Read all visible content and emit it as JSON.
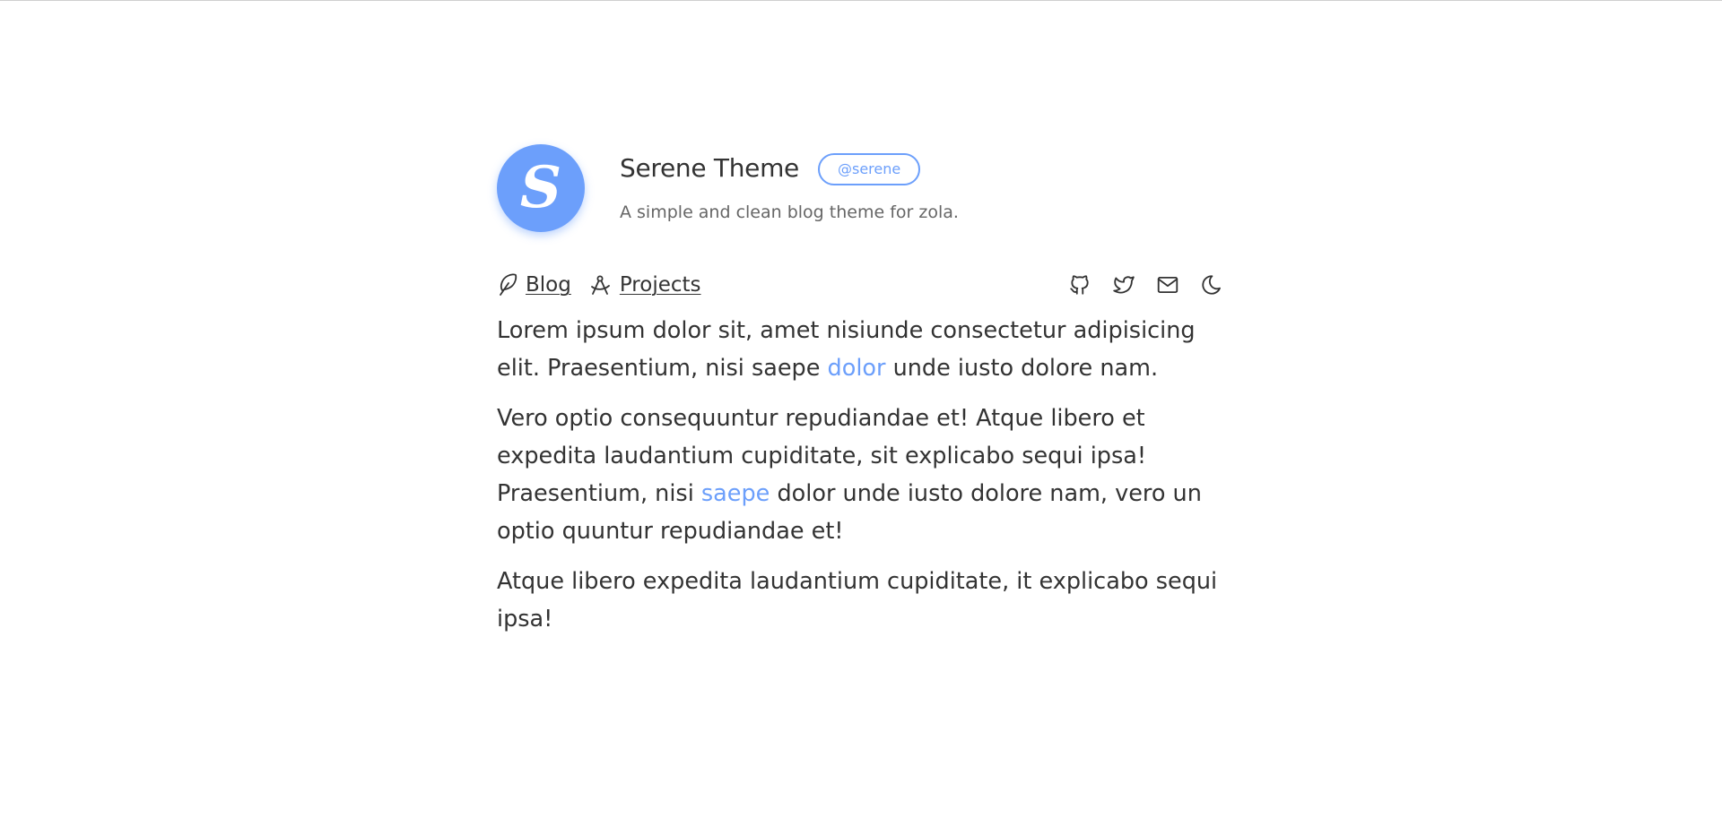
{
  "header": {
    "avatar_letter": "S",
    "title": "Serene Theme",
    "handle": "@serene",
    "tagline": "A simple and clean blog theme for zola."
  },
  "nav": {
    "links": [
      {
        "label": "Blog",
        "icon": "feather-icon"
      },
      {
        "label": "Projects",
        "icon": "compass-icon"
      }
    ],
    "icons": [
      "github-icon",
      "twitter-icon",
      "mail-icon",
      "moon-icon"
    ]
  },
  "content": {
    "p1_a": "Lorem ipsum dolor sit, amet nisiunde consectetur adipisicing elit. Praesentium, nisi saepe ",
    "p1_link": "dolor",
    "p1_b": " unde iusto dolore nam.",
    "p2_a": "Vero optio consequuntur repudiandae et! Atque libero et expedita laudantium cupiditate, sit explicabo sequi ipsa! Praesentium, nisi ",
    "p2_link": "saepe",
    "p2_b": " dolor unde iusto dolore nam, vero un optio quuntur repudiandae et!",
    "p3": "Atque libero expedita laudantium cupiditate, it explicabo sequi ipsa!"
  },
  "colors": {
    "accent": "#6c9ffb",
    "text": "#333333",
    "muted": "#666666"
  }
}
